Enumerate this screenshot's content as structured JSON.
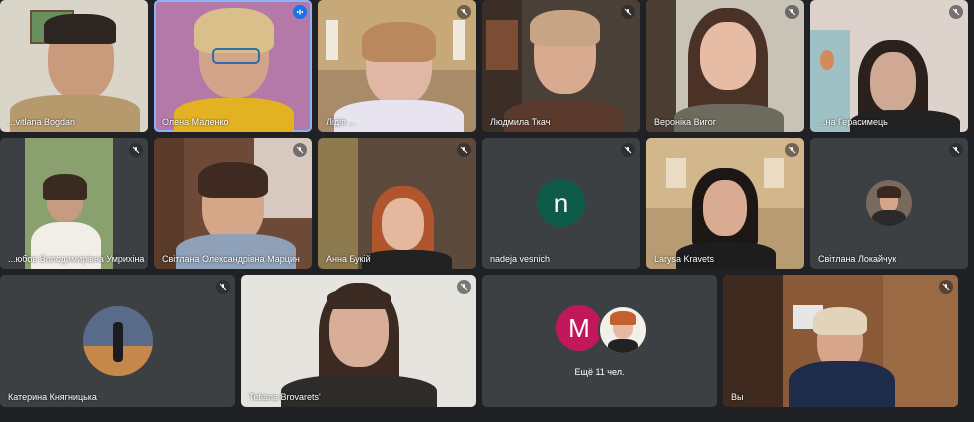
{
  "colors": {
    "background": "#202124",
    "tile": "#3c4043",
    "active_outline": "#8ab4f8",
    "avatar_n": "#0f5b4a",
    "avatar_m": "#c2185b"
  },
  "participants": [
    {
      "name": "...vitlana Bogdan",
      "mic": "none"
    },
    {
      "name": "Олена Маленко",
      "mic": "speaking"
    },
    {
      "name": "Лідія ...",
      "mic": "muted"
    },
    {
      "name": "Людмила Ткач",
      "mic": "muted"
    },
    {
      "name": "Вероніка Вигог",
      "mic": "muted"
    },
    {
      "name": "...на Герасимець",
      "mic": "muted"
    },
    {
      "name": "...юбов Володимирівна Умрихіна",
      "mic": "muted"
    },
    {
      "name": "Світлана Олександрівна Марцин",
      "mic": "muted"
    },
    {
      "name": "Анна Букій",
      "mic": "muted"
    },
    {
      "name": "nadeja vesnich",
      "mic": "muted",
      "avatar_letter": "n"
    },
    {
      "name": "Larysa Kravets",
      "mic": "muted"
    },
    {
      "name": "Світлана Локайчук",
      "mic": "muted"
    },
    {
      "name": "Катерина Княгницька",
      "mic": "muted"
    },
    {
      "name": "Tetiana Brovarets'",
      "mic": "muted"
    },
    {
      "name": "Вы",
      "mic": "muted"
    }
  ],
  "more_tile": {
    "avatar_letter": "M",
    "label": "Ещё 11 чел."
  },
  "icons": {
    "muted": "mic-off-icon",
    "speaking": "audio-bars-icon"
  }
}
